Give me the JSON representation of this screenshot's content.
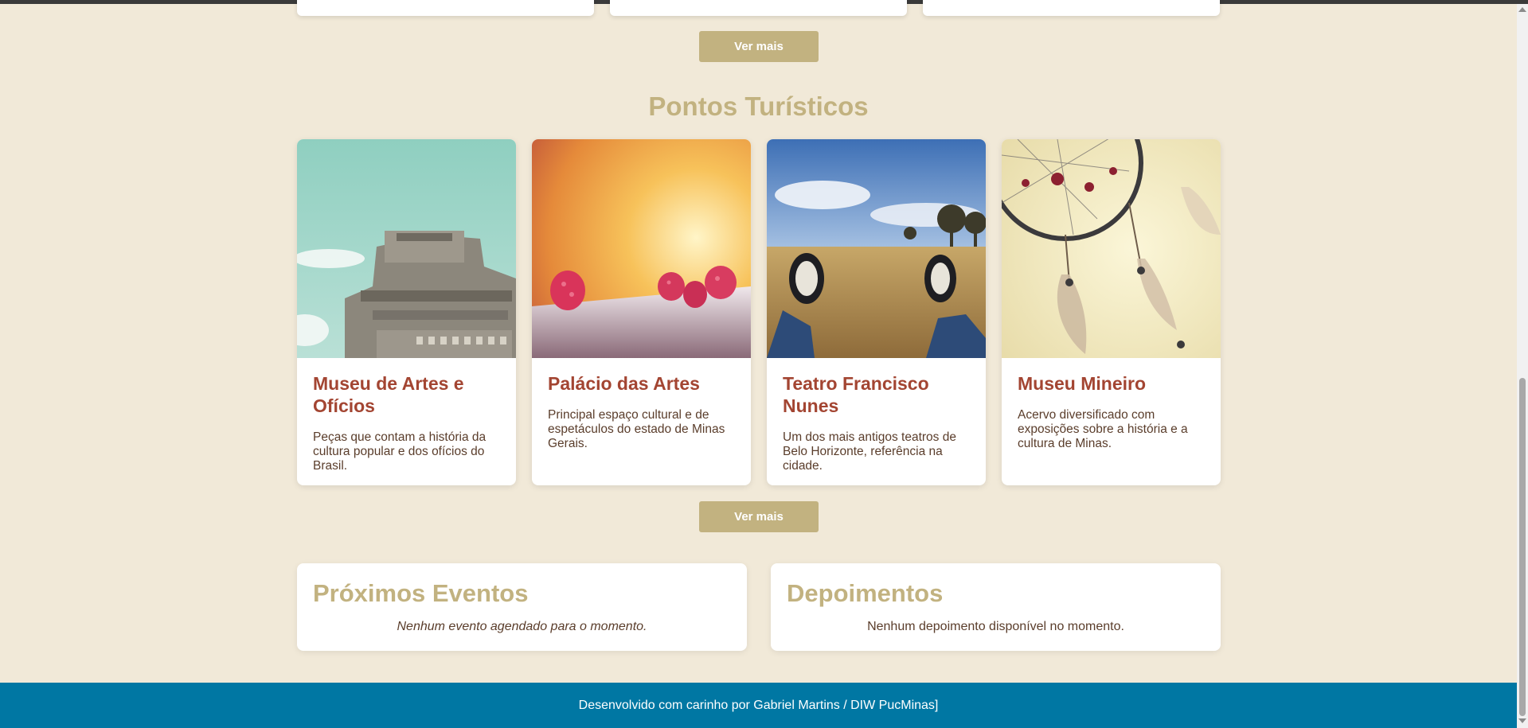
{
  "top_section": {
    "button_label": "Ver mais"
  },
  "tourist": {
    "title": "Pontos Turísticos",
    "button_label": "Ver mais",
    "cards": [
      {
        "title": "Museu de Artes e Ofícios",
        "description": "Peças que contam a história da cultura popular e dos ofícios do Brasil."
      },
      {
        "title": "Palácio das Artes",
        "description": "Principal espaço cultural e de espetáculos do estado de Minas Gerais."
      },
      {
        "title": "Teatro Francisco Nunes",
        "description": "Um dos mais antigos teatros de Belo Horizonte, referência na cidade."
      },
      {
        "title": "Museu Mineiro",
        "description": "Acervo diversificado com exposições sobre a história e a cultura de Minas."
      }
    ]
  },
  "events": {
    "title": "Próximos Eventos",
    "empty_text": "Nenhum evento agendado para o momento."
  },
  "testimonials": {
    "title": "Depoimentos",
    "empty_text": "Nenhum depoimento disponível no momento."
  },
  "footer": {
    "text": "Desenvolvido com carinho por Gabriel Martins / DIW PucMinas]"
  },
  "colors": {
    "background": "#f1e9d8",
    "accent": "#c2b280",
    "card_title": "#a34532",
    "footer": "#0077a3"
  }
}
